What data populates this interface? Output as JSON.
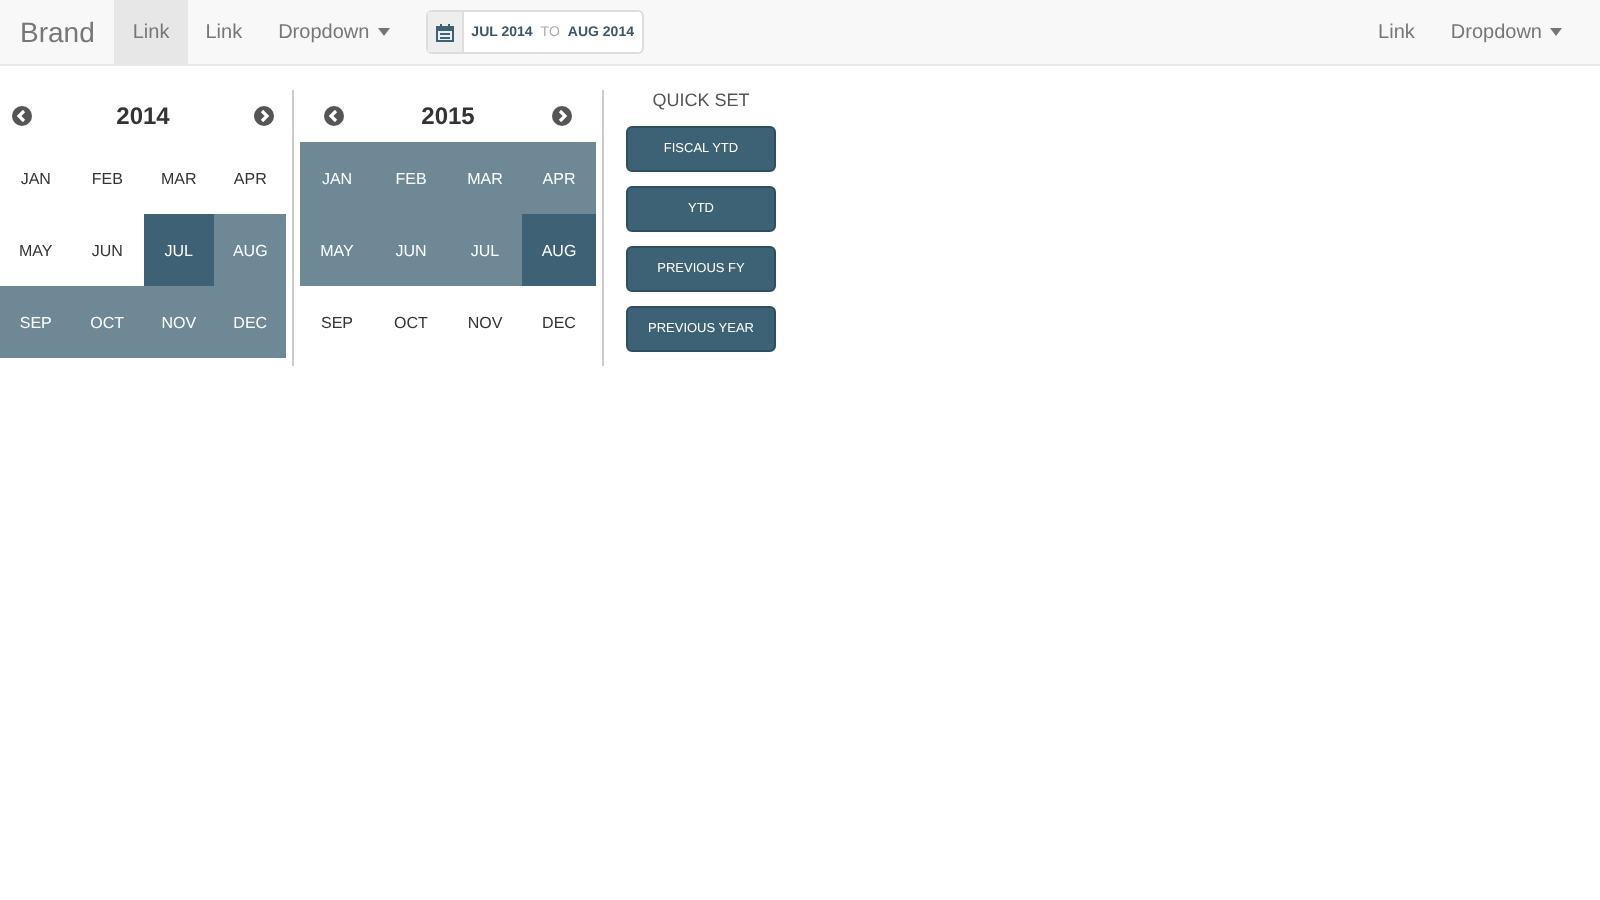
{
  "navbar": {
    "brand": "Brand",
    "left_links": [
      {
        "label": "Link",
        "selected": true
      },
      {
        "label": "Link",
        "selected": false
      }
    ],
    "left_dropdown": "Dropdown",
    "date_range": {
      "from": "JUL 2014",
      "separator": "TO",
      "to": "AUG 2014"
    },
    "right_links": [
      {
        "label": "Link",
        "selected": false
      }
    ],
    "right_dropdown": "Dropdown"
  },
  "calendars": [
    {
      "year": "2014",
      "months": [
        {
          "label": "JAN",
          "selected": false,
          "in_range": false
        },
        {
          "label": "FEB",
          "selected": false,
          "in_range": false
        },
        {
          "label": "MAR",
          "selected": false,
          "in_range": false
        },
        {
          "label": "APR",
          "selected": false,
          "in_range": false
        },
        {
          "label": "MAY",
          "selected": false,
          "in_range": false
        },
        {
          "label": "JUN",
          "selected": false,
          "in_range": false
        },
        {
          "label": "JUL",
          "selected": true,
          "in_range": false
        },
        {
          "label": "AUG",
          "selected": false,
          "in_range": true
        },
        {
          "label": "SEP",
          "selected": false,
          "in_range": true
        },
        {
          "label": "OCT",
          "selected": false,
          "in_range": true
        },
        {
          "label": "NOV",
          "selected": false,
          "in_range": true
        },
        {
          "label": "DEC",
          "selected": false,
          "in_range": true
        }
      ]
    },
    {
      "year": "2015",
      "months": [
        {
          "label": "JAN",
          "selected": false,
          "in_range": true
        },
        {
          "label": "FEB",
          "selected": false,
          "in_range": true
        },
        {
          "label": "MAR",
          "selected": false,
          "in_range": true
        },
        {
          "label": "APR",
          "selected": false,
          "in_range": true
        },
        {
          "label": "MAY",
          "selected": false,
          "in_range": true
        },
        {
          "label": "JUN",
          "selected": false,
          "in_range": true
        },
        {
          "label": "JUL",
          "selected": false,
          "in_range": true
        },
        {
          "label": "AUG",
          "selected": true,
          "in_range": false
        },
        {
          "label": "SEP",
          "selected": false,
          "in_range": false
        },
        {
          "label": "OCT",
          "selected": false,
          "in_range": false
        },
        {
          "label": "NOV",
          "selected": false,
          "in_range": false
        },
        {
          "label": "DEC",
          "selected": false,
          "in_range": false
        }
      ]
    }
  ],
  "quick_set": {
    "title": "QUICK SET",
    "buttons": [
      "FISCAL YTD",
      "YTD",
      "PREVIOUS FY",
      "PREVIOUS YEAR"
    ]
  }
}
